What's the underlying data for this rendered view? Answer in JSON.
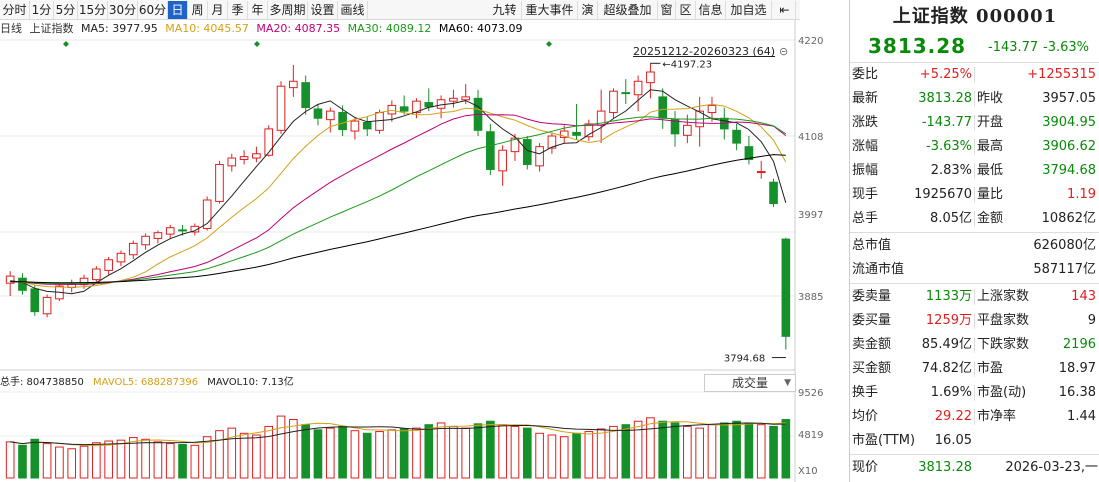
{
  "toolbar": {
    "left_items": [
      "分时",
      "1分",
      "5分",
      "15分",
      "30分",
      "60分",
      "日",
      "周",
      "月",
      "季",
      "年",
      "多周期",
      "设置",
      "画线"
    ],
    "active_item": "日",
    "right_items": [
      "九转",
      "重大事件",
      "演",
      "超级叠加",
      "窗",
      "区",
      "信息",
      "加自选"
    ]
  },
  "legend": {
    "period": "日线",
    "name": "上证指数",
    "ma5": "MA5: 3977.95",
    "ma10": "MA10: 4045.57",
    "ma20": "MA20: 4087.35",
    "ma30": "MA30: 4089.12",
    "ma60": "MA60: 4073.09"
  },
  "range_label": "20251212-20260323 (64)",
  "price_axis": [
    "4220",
    "4108",
    "3997",
    "3885"
  ],
  "annotations": {
    "high": "4197.23",
    "low": "3794.68"
  },
  "volume": {
    "legend_total": "总手: 804738850",
    "legend_mavol5": "MAVOL5: 688287396",
    "legend_mavol10": "MAVOL10: 7.13亿",
    "selector": "成交量",
    "axis": [
      "9526",
      "4819",
      "X10"
    ]
  },
  "chart_data": {
    "type": "candlestick",
    "ohlc": [
      [
        3888,
        3905,
        3870,
        3898
      ],
      [
        3895,
        3902,
        3872,
        3878
      ],
      [
        3880,
        3885,
        3842,
        3848
      ],
      [
        3845,
        3872,
        3840,
        3868
      ],
      [
        3866,
        3888,
        3863,
        3884
      ],
      [
        3882,
        3893,
        3875,
        3888
      ],
      [
        3886,
        3900,
        3880,
        3895
      ],
      [
        3893,
        3912,
        3888,
        3908
      ],
      [
        3906,
        3925,
        3900,
        3921
      ],
      [
        3918,
        3934,
        3912,
        3930
      ],
      [
        3928,
        3948,
        3922,
        3944
      ],
      [
        3942,
        3958,
        3935,
        3954
      ],
      [
        3951,
        3962,
        3944,
        3959
      ],
      [
        3957,
        3970,
        3950,
        3966
      ],
      [
        3963,
        3970,
        3955,
        3962
      ],
      [
        3960,
        3972,
        3955,
        3968
      ],
      [
        3965,
        4010,
        3962,
        4005
      ],
      [
        4003,
        4060,
        4000,
        4055
      ],
      [
        4053,
        4070,
        4045,
        4064
      ],
      [
        4062,
        4075,
        4055,
        4066
      ],
      [
        4064,
        4080,
        4058,
        4070
      ],
      [
        4068,
        4110,
        4066,
        4105
      ],
      [
        4103,
        4172,
        4098,
        4165
      ],
      [
        4163,
        4195,
        4150,
        4172
      ],
      [
        4170,
        4180,
        4125,
        4135
      ],
      [
        4133,
        4140,
        4110,
        4120
      ],
      [
        4118,
        4135,
        4100,
        4130
      ],
      [
        4128,
        4138,
        4095,
        4104
      ],
      [
        4102,
        4120,
        4090,
        4116
      ],
      [
        4114,
        4122,
        4095,
        4105
      ],
      [
        4103,
        4132,
        4098,
        4128
      ],
      [
        4126,
        4145,
        4115,
        4138
      ],
      [
        4136,
        4152,
        4125,
        4130
      ],
      [
        4128,
        4148,
        4120,
        4144
      ],
      [
        4142,
        4162,
        4130,
        4136
      ],
      [
        4134,
        4152,
        4120,
        4146
      ],
      [
        4144,
        4160,
        4135,
        4148
      ],
      [
        4146,
        4168,
        4140,
        4150
      ],
      [
        4148,
        4160,
        4095,
        4103
      ],
      [
        4101,
        4112,
        4040,
        4048
      ],
      [
        4046,
        4082,
        4025,
        4075
      ],
      [
        4073,
        4098,
        4060,
        4092
      ],
      [
        4090,
        4095,
        4048,
        4055
      ],
      [
        4053,
        4085,
        4045,
        4080
      ],
      [
        4078,
        4100,
        4070,
        4095
      ],
      [
        4093,
        4110,
        4085,
        4102
      ],
      [
        4100,
        4140,
        4090,
        4096
      ],
      [
        4094,
        4118,
        4088,
        4112
      ],
      [
        4110,
        4160,
        4085,
        4130
      ],
      [
        4128,
        4162,
        4120,
        4158
      ],
      [
        4156,
        4175,
        4140,
        4155
      ],
      [
        4153,
        4180,
        4130,
        4172
      ],
      [
        4170,
        4197.23,
        4148,
        4185
      ],
      [
        4150,
        4162,
        4105,
        4120
      ],
      [
        4118,
        4130,
        4080,
        4098
      ],
      [
        4096,
        4125,
        4085,
        4110
      ],
      [
        4108,
        4150,
        4080,
        4130
      ],
      [
        4128,
        4150,
        4115,
        4138
      ],
      [
        4120,
        4135,
        4090,
        4105
      ],
      [
        4103,
        4112,
        4075,
        4085
      ],
      [
        4080,
        4095,
        4055,
        4062
      ],
      [
        4045,
        4060,
        4035,
        4045
      ],
      [
        4030,
        4035,
        3995,
        4000
      ],
      [
        3950,
        3952,
        3794.68,
        3813.28
      ]
    ],
    "ma_series": [
      {
        "name": "MA5",
        "color": "#222222"
      },
      {
        "name": "MA10",
        "color": "#d4a017"
      },
      {
        "name": "MA20",
        "color": "#c0007a"
      },
      {
        "name": "MA30",
        "color": "#1a9a1a"
      },
      {
        "name": "MA60",
        "color": "#000000"
      }
    ],
    "volume_relative": [
      0.42,
      0.38,
      0.45,
      0.4,
      0.36,
      0.34,
      0.37,
      0.41,
      0.43,
      0.44,
      0.47,
      0.45,
      0.42,
      0.4,
      0.39,
      0.38,
      0.48,
      0.55,
      0.58,
      0.52,
      0.5,
      0.6,
      0.72,
      0.68,
      0.62,
      0.56,
      0.58,
      0.6,
      0.55,
      0.52,
      0.54,
      0.56,
      0.57,
      0.58,
      0.62,
      0.64,
      0.6,
      0.58,
      0.63,
      0.66,
      0.62,
      0.6,
      0.58,
      0.52,
      0.5,
      0.48,
      0.52,
      0.54,
      0.57,
      0.6,
      0.62,
      0.66,
      0.7,
      0.66,
      0.64,
      0.6,
      0.58,
      0.62,
      0.64,
      0.66,
      0.64,
      0.62,
      0.6,
      0.68
    ],
    "ylim": [
      3780,
      4230
    ]
  },
  "quote": {
    "title": "上证指数 000001",
    "price": "3813.28",
    "change": "-143.77",
    "change_pct": "-3.63%",
    "rows": [
      {
        "l1": "委比",
        "v1": "+5.25%",
        "c1": "red",
        "l2": "",
        "v2": "+1255315",
        "c2": "red"
      },
      {
        "l1": "最新",
        "v1": "3813.28",
        "c1": "green",
        "l2": "昨收",
        "v2": "3957.05",
        "c2": "dark"
      },
      {
        "l1": "涨跌",
        "v1": "-143.77",
        "c1": "green",
        "l2": "开盘",
        "v2": "3904.95",
        "c2": "green"
      },
      {
        "l1": "涨幅",
        "v1": "-3.63%",
        "c1": "green",
        "l2": "最高",
        "v2": "3906.62",
        "c2": "green"
      },
      {
        "l1": "振幅",
        "v1": "2.83%",
        "c1": "dark",
        "l2": "最低",
        "v2": "3794.68",
        "c2": "green"
      },
      {
        "l1": "现手",
        "v1": "1925670",
        "c1": "dark",
        "l2": "量比",
        "v2": "1.19",
        "c2": "red"
      },
      {
        "l1": "总手",
        "v1": "8.05亿",
        "c1": "dark",
        "l2": "金额",
        "v2": "10862亿",
        "c2": "dark"
      }
    ],
    "cap_rows": [
      {
        "l": "总市值",
        "v": "626080亿"
      },
      {
        "l": "流通市值",
        "v": "587117亿"
      }
    ],
    "rows2": [
      {
        "l1": "委卖量",
        "v1": "1133万",
        "c1": "green",
        "l2": "上涨家数",
        "v2": "143",
        "c2": "red"
      },
      {
        "l1": "委买量",
        "v1": "1259万",
        "c1": "red",
        "l2": "平盘家数",
        "v2": "9",
        "c2": "dark"
      },
      {
        "l1": "卖金额",
        "v1": "85.49亿",
        "c1": "dark",
        "l2": "下跌家数",
        "v2": "2196",
        "c2": "green"
      },
      {
        "l1": "买金额",
        "v1": "74.82亿",
        "c1": "dark",
        "l2": "市盈",
        "v2": "18.97",
        "c2": "dark"
      },
      {
        "l1": "换手",
        "v1": "1.69%",
        "c1": "dark",
        "l2": "市盈(动)",
        "v2": "16.38",
        "c2": "dark"
      },
      {
        "l1": "均价",
        "v1": "29.22",
        "c1": "red",
        "l2": "市净率",
        "v2": "1.44",
        "c2": "dark"
      },
      {
        "l1": "市盈(TTM)",
        "v1": "16.05",
        "c1": "dark",
        "l2": "",
        "v2": "",
        "c2": "dark"
      }
    ],
    "last": {
      "label": "现价",
      "price": "3813.28",
      "time": "2026-03-23,一"
    }
  },
  "colors": {
    "up": "#e02020",
    "down": "#16902a",
    "grid": "#e6e6e6",
    "accent": "#1e64c8"
  }
}
